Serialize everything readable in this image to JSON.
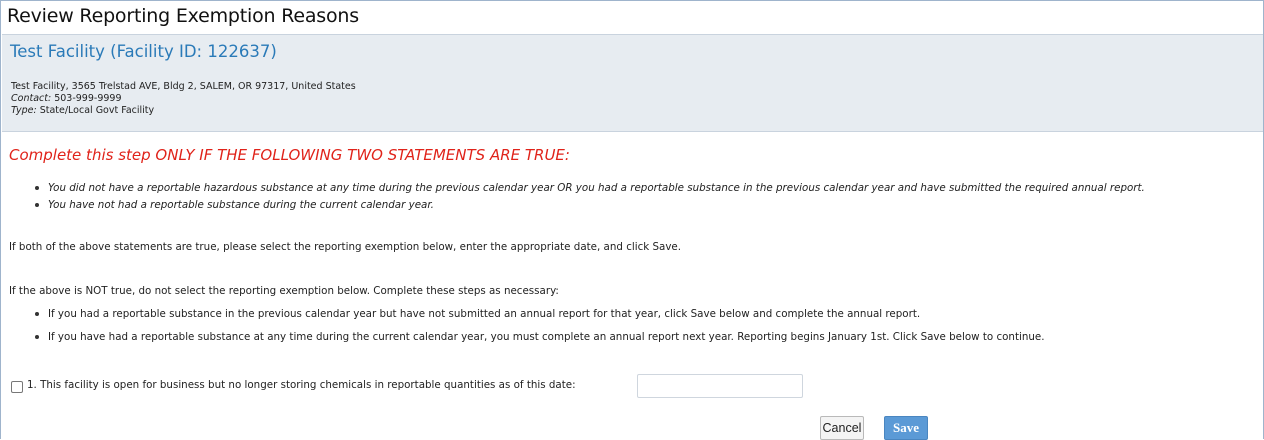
{
  "page": {
    "title": "Review Reporting Exemption Reasons"
  },
  "facility": {
    "name": "Test Facility (Facility ID: 122637)",
    "address": "Test Facility, 3565 Trelstad AVE, Bldg 2, SALEM, OR 97317, United States",
    "contact_label": "Contact:",
    "contact_value": " 503-999-9999",
    "type_label": "Type:",
    "type_value": " State/Local Govt Facility"
  },
  "instructions": {
    "warning": "Complete this step ONLY IF THE FOLLOWING TWO STATEMENTS ARE TRUE:",
    "conditions": [
      "You did not have a reportable hazardous substance at any time during the previous calendar year OR you had a reportable substance in the previous calendar year and have submitted the required annual report.",
      "You have not had a reportable substance during the current calendar year."
    ],
    "paragraph_true": "If both of the above statements are true, please select the reporting exemption below, enter the appropriate date, and click Save.",
    "paragraph_not_true": "If the above is NOT true, do not select the reporting exemption below. Complete these steps as necessary:",
    "steps": [
      "If you had a reportable substance in the previous calendar year but have not submitted an annual report for that year, click Save below and complete the annual report.",
      "If you have had a reportable substance at any time during the current calendar year, you must complete an annual report next year. Reporting begins January 1st. Click Save below to continue."
    ]
  },
  "exemption": {
    "checked": false,
    "label": "1. This facility is open for business but no longer storing chemicals in reportable quantities as of this date:",
    "date_value": "",
    "date_placeholder": ""
  },
  "actions": {
    "cancel_label": "Cancel",
    "save_label": "Save"
  },
  "colors": {
    "title_blue": "#2a7ab8",
    "warning_red": "#e0231a",
    "panel_bg": "#e7ecf1",
    "save_blue": "#5b9ad6"
  }
}
